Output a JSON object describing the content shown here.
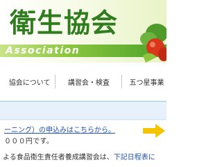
{
  "header": {
    "title": "衛生協会",
    "subtitle_en": "Association"
  },
  "nav": {
    "items": [
      {
        "label": "協会について"
      },
      {
        "label": "講習会・検査"
      },
      {
        "label": "五つ星事業"
      }
    ]
  },
  "notice": {
    "link_text": "ーニング）の申込みはこちらから。",
    "fee_text": "０００円です。"
  },
  "paragraph": {
    "lead": "よる食品衛生責任者養成講習会は、",
    "link_text": "下記日程表に"
  },
  "colors": {
    "brand_green": "#2f7d1e",
    "link_blue": "#1f4fb0",
    "arrow_yellow": "#f5c400"
  },
  "icons": {
    "banner_art": "vegetable-illustration",
    "arrow": "arrow-right-icon"
  }
}
